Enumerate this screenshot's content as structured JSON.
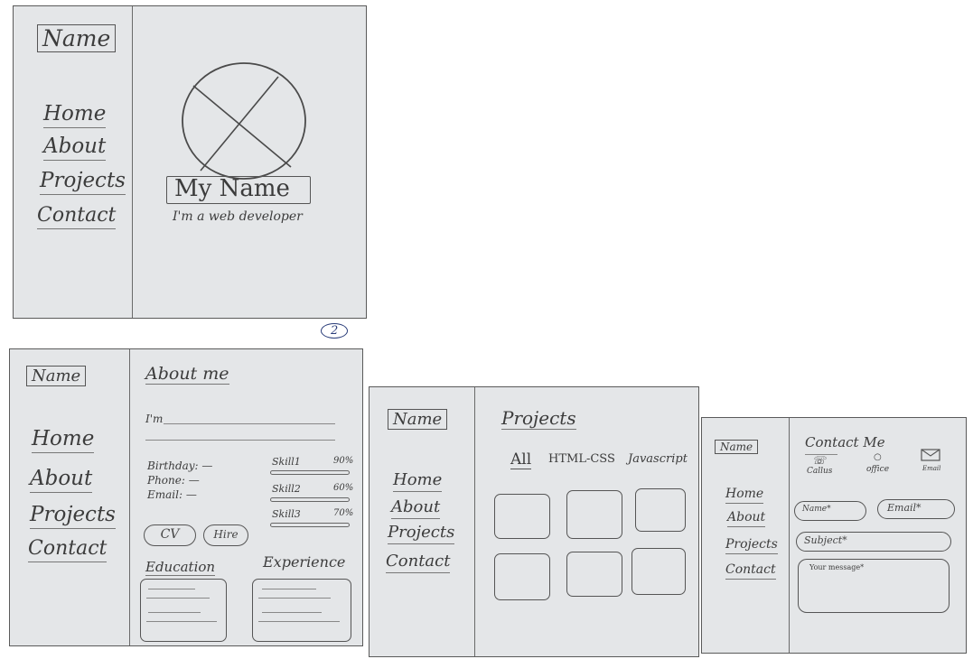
{
  "sheet1": {
    "brand": "Name",
    "nav": [
      "Home",
      "About",
      "Projects",
      "Contact"
    ],
    "hero_name": "My Name",
    "tagline": "I'm a web developer",
    "page_marker": "2"
  },
  "sheet2": {
    "brand": "Name",
    "nav": [
      "Home",
      "About",
      "Projects",
      "Contact"
    ],
    "title": "About me",
    "intro": "I'm",
    "info": [
      "Birthday: —",
      "Phone: —",
      "Email: —"
    ],
    "skills": [
      {
        "label": "Skill1",
        "pct": "90%",
        "level": 0.9
      },
      {
        "label": "Skill2",
        "pct": "60%",
        "level": 0.6
      },
      {
        "label": "Skill3",
        "pct": "70%",
        "level": 0.7
      }
    ],
    "buttons": [
      "CV",
      "Hire"
    ],
    "education": "Education",
    "experience": "Experience"
  },
  "sheet3": {
    "brand": "Name",
    "nav": [
      "Home",
      "About",
      "Projects",
      "Contact"
    ],
    "title": "Projects",
    "filters": [
      "All",
      "HTML-CSS",
      "Javascript"
    ]
  },
  "sheet4": {
    "brand": "Name",
    "nav": [
      "Home",
      "About",
      "Projects",
      "Contact"
    ],
    "title": "Contact Me",
    "channels": [
      "Callus",
      "office",
      "Email"
    ],
    "fields": {
      "name": "Name*",
      "email": "Email*",
      "subject": "Subject*",
      "message": "Your message*"
    }
  }
}
